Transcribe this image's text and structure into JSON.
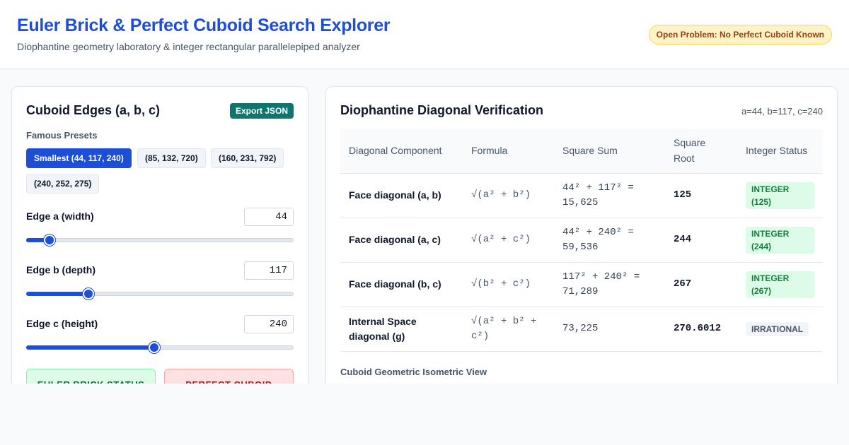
{
  "header": {
    "title": "Euler Brick & Perfect Cuboid Search Explorer",
    "subtitle": "Diophantine geometry laboratory & integer rectangular parallelepiped analyzer",
    "badge": "Open Problem: No Perfect Cuboid Known"
  },
  "edges_panel": {
    "title": "Cuboid Edges (a, b, c)",
    "export_label": "Export JSON",
    "presets_label": "Famous Presets",
    "presets": [
      "Smallest (44, 117, 240)",
      "(85, 132, 720)",
      "(160, 231, 792)",
      "(240, 252, 275)"
    ],
    "active_preset": 0,
    "slider_max": 500,
    "edges": [
      {
        "label": "Edge a (width)",
        "value": "44"
      },
      {
        "label": "Edge b (depth)",
        "value": "117"
      },
      {
        "label": "Edge c (height)",
        "value": "240"
      }
    ],
    "status": {
      "euler": "EULER BRICK STATUS",
      "perfect": "PERFECT CUBOID"
    }
  },
  "verification": {
    "title": "Diophantine Diagonal Verification",
    "params": "a=44, b=117, c=240",
    "columns": [
      "Diagonal Component",
      "Formula",
      "Square Sum",
      "Square Root",
      "Integer Status"
    ],
    "rows": [
      {
        "component": "Face diagonal (a, b)",
        "formula": "√(a² + b²)",
        "square_sum": "44² + 117² = 15,625",
        "root": "125",
        "status": "INTEGER (125)",
        "kind": "integer"
      },
      {
        "component": "Face diagonal (a, c)",
        "formula": "√(a² + c²)",
        "square_sum": "44² + 240² = 59,536",
        "root": "244",
        "status": "INTEGER (244)",
        "kind": "integer"
      },
      {
        "component": "Face diagonal (b, c)",
        "formula": "√(b² + c²)",
        "square_sum": "117² + 240² = 71,289",
        "root": "267",
        "status": "INTEGER (267)",
        "kind": "integer"
      },
      {
        "component": "Internal Space diagonal (g)",
        "formula": "√(a² + b² + c²)",
        "square_sum": "73,225",
        "root": "270.6012",
        "status": "IRRATIONAL",
        "kind": "irrational"
      }
    ],
    "iso_label": "Cuboid Geometric Isometric View"
  }
}
